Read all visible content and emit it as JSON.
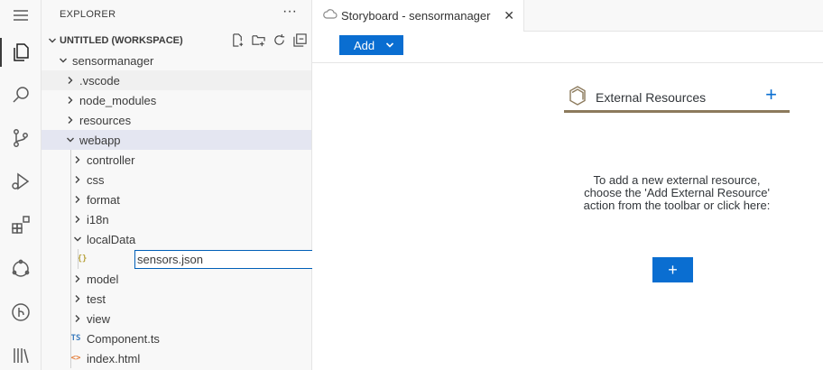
{
  "explorer": {
    "header": "EXPLORER",
    "more": "···",
    "workspace": "UNTITLED (WORKSPACE)",
    "tree": [
      {
        "label": "sensormanager"
      },
      {
        "label": ".vscode"
      },
      {
        "label": "node_modules"
      },
      {
        "label": "resources"
      },
      {
        "label": "webapp"
      },
      {
        "label": "controller"
      },
      {
        "label": "css"
      },
      {
        "label": "format"
      },
      {
        "label": "i18n"
      },
      {
        "label": "localData"
      },
      {
        "label": "model"
      },
      {
        "label": "test"
      },
      {
        "label": "view"
      },
      {
        "label": "Component.ts",
        "icon_text": "TS"
      },
      {
        "label": "index.html",
        "icon_text": "<>"
      }
    ],
    "json_icon_text": "{}",
    "rename_value": "sensors.json"
  },
  "tab": {
    "label": "Storyboard - sensormanager",
    "close": "✕"
  },
  "toolbar": {
    "add_label": "Add"
  },
  "external_resources": {
    "title": "External Resources",
    "plus": "+",
    "message": "To add a new external resource, choose the 'Add External Resource' action from the toolbar or click here:",
    "add_button": "+"
  },
  "colors": {
    "accent": "#0a6ed1",
    "panel_border": "#8c7a5c",
    "selected_row": "#e4e6f1"
  }
}
